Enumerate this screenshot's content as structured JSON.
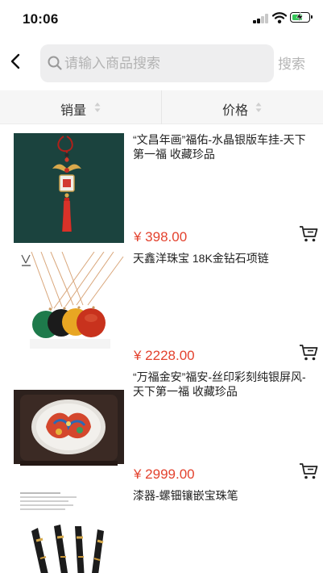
{
  "status": {
    "time": "10:06"
  },
  "search": {
    "placeholder": "请输入商品搜索",
    "button_label": "搜索"
  },
  "sort": {
    "sales_label": "销量",
    "price_label": "价格"
  },
  "products": [
    {
      "title": "“文昌年画”福佑-水晶银版车挂-天下第一福 收藏珍品",
      "price": "¥ 398.00"
    },
    {
      "title": "天鑫洋珠宝 18K金钻石项链",
      "price": "¥ 2228.00"
    },
    {
      "title": "“万福金安”福安-丝印彩刻纯银屏风-天下第一福 收藏珍品",
      "price": "¥ 2999.00"
    },
    {
      "title": "漆器-螺钿镶嵌宝珠笔",
      "price": ""
    }
  ],
  "colors": {
    "price": "#e3422e",
    "search_bg": "#eeeeef",
    "sort_bar_bg": "#f6f6f6",
    "battery": "#35c759"
  },
  "icons": {
    "back": "chevron-left-icon",
    "search": "search-icon",
    "cart": "cart-icon",
    "sort": "sort-arrows-icon"
  }
}
